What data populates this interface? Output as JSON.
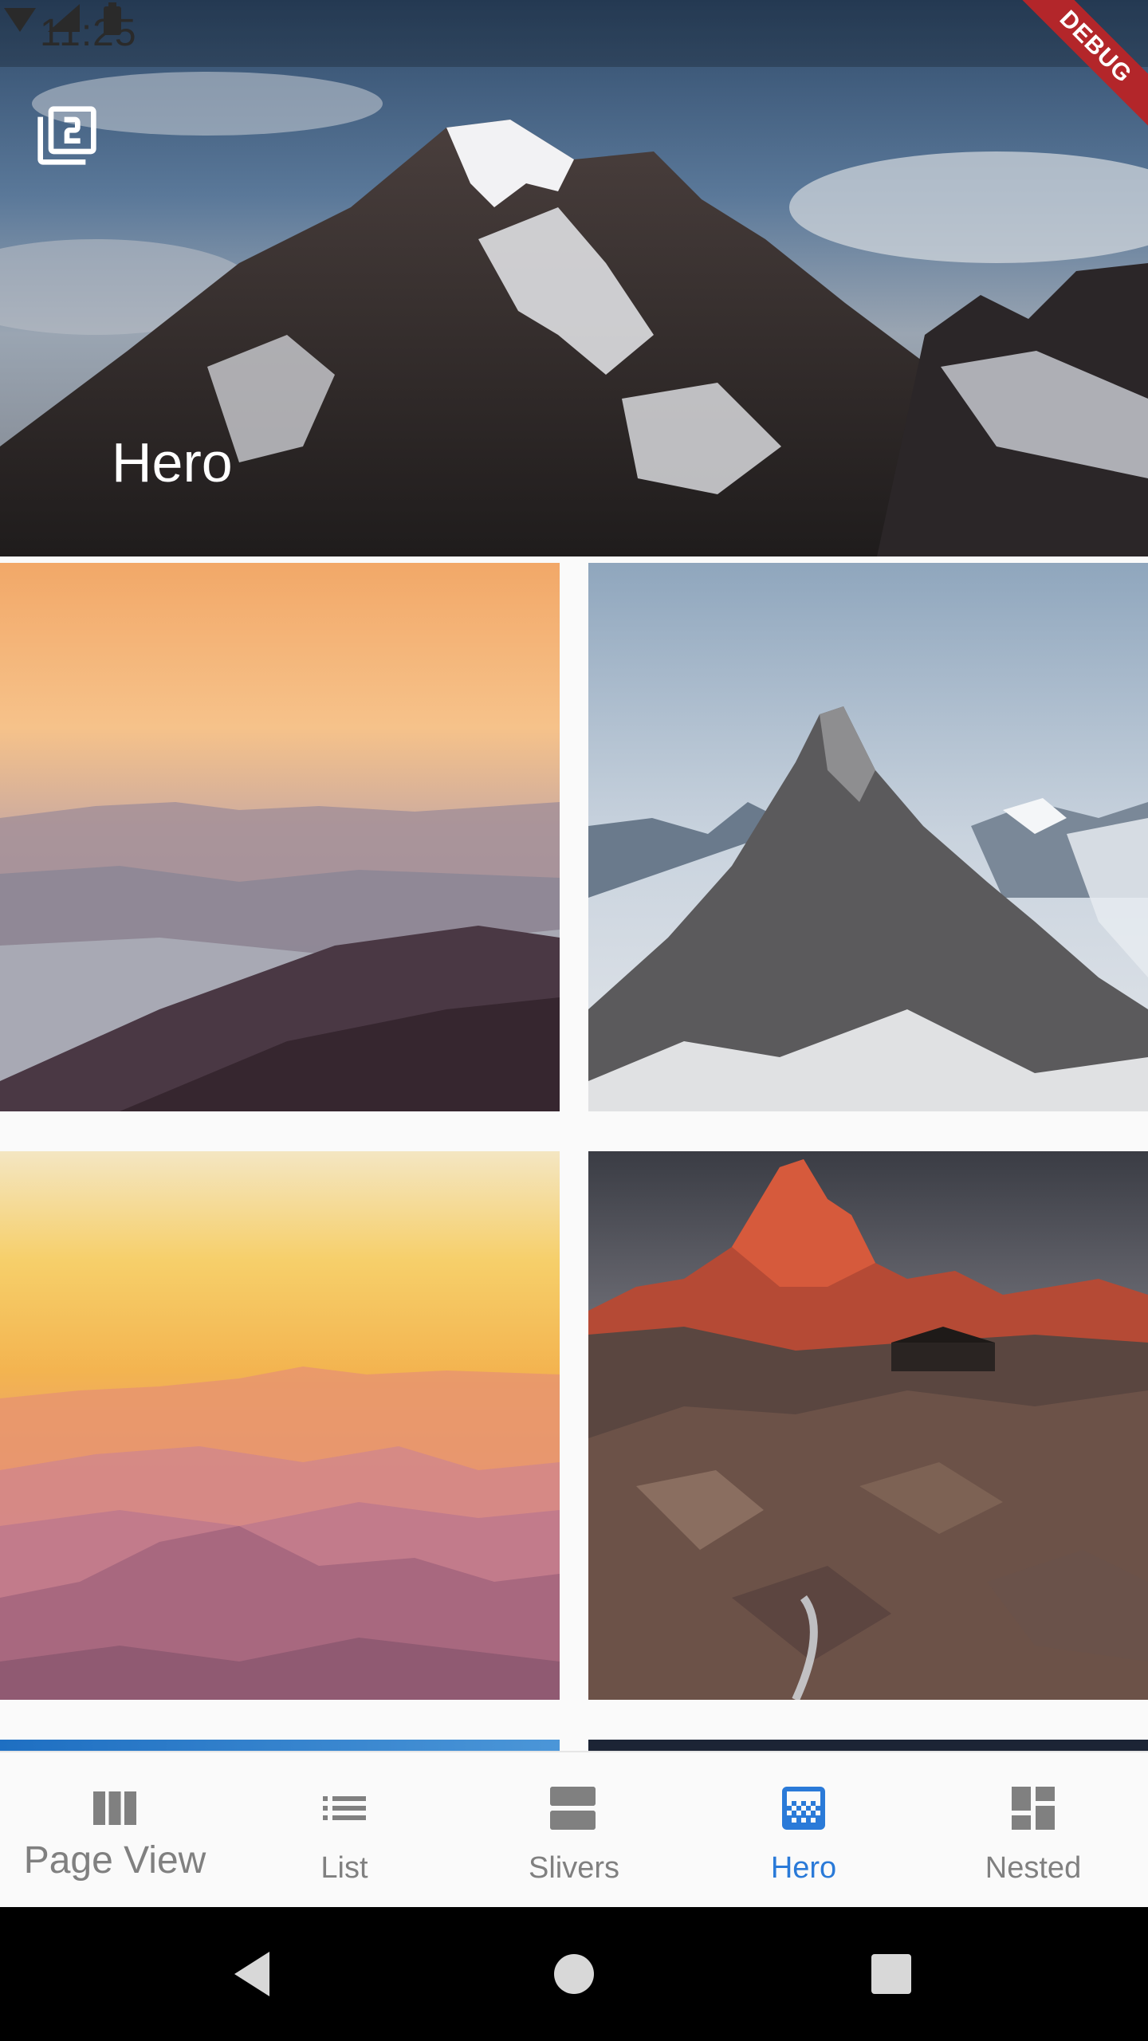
{
  "status_bar": {
    "time": "11:25"
  },
  "debug_banner": {
    "label": "DEBUG"
  },
  "header": {
    "title": "Hero",
    "action_icon": "filter-2-icon"
  },
  "grid": {
    "tiles": [
      {
        "name": "sunset-hazy-mountain-range",
        "icon": "image"
      },
      {
        "name": "snowy-rocky-peak",
        "icon": "image"
      },
      {
        "name": "golden-layered-mountains",
        "icon": "image"
      },
      {
        "name": "red-peak-with-cabin",
        "icon": "image"
      },
      {
        "name": "blue-partial-tile",
        "icon": "image"
      },
      {
        "name": "night-sky-partial-tile",
        "icon": "image"
      }
    ]
  },
  "bottom_nav": {
    "items": [
      {
        "label": "Page View",
        "icon": "view-column-icon",
        "active": false
      },
      {
        "label": "List",
        "icon": "list-icon",
        "active": false
      },
      {
        "label": "Slivers",
        "icon": "view-agenda-icon",
        "active": false
      },
      {
        "label": "Hero",
        "icon": "gradient-icon",
        "active": true
      },
      {
        "label": "Nested",
        "icon": "dashboard-icon",
        "active": false
      }
    ]
  },
  "colors": {
    "accent": "#2a7ad8",
    "inactive": "#808080",
    "debug_ribbon": "#b3262a",
    "background": "#fafafa"
  }
}
